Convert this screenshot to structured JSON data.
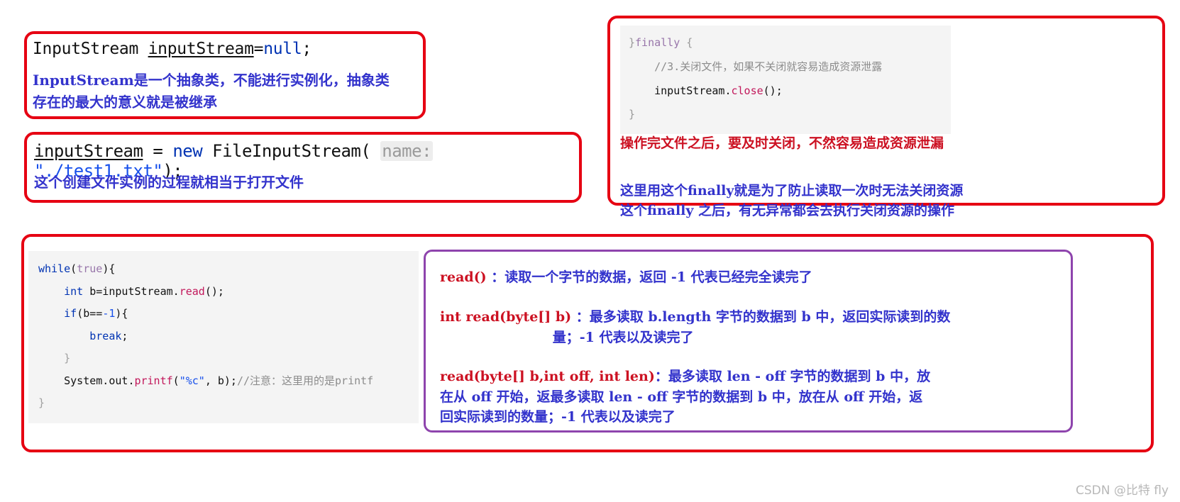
{
  "boxes": {
    "declaration": {
      "code": {
        "type_name": "InputStream",
        "variable": "inputStream",
        "assign": "=",
        "value": "null",
        "semi": ";"
      },
      "note": "InputStream是一个抽象类，不能进行实例化，抽象类\n存在的最大的意义就是被继承"
    },
    "new_stream": {
      "code": {
        "variable": "inputStream",
        "assign": " = ",
        "keyword": "new",
        "constructor": " FileInputStream(",
        "param_hint": "name:",
        "string_arg": "\"./test1.txt\"",
        "tail": ");"
      },
      "note": "这个创建文件实例的过程就相当于打开文件"
    },
    "finally_block": {
      "code_lines": [
        {
          "close_brace": "}",
          "keyword": "finally",
          "open": " {"
        },
        {
          "comment": "    //3.关闭文件，如果不关闭就容易造成资源泄露"
        },
        {
          "object": "    inputStream",
          "dot": ".",
          "method": "close",
          "tail": "();"
        },
        {
          "close_brace": "}"
        }
      ],
      "note_1": "操作完文件之后，要及时关闭，不然容易造成资源泄漏",
      "note_2": "这里用这个finally就是为了防止读取一次时无法关闭资源\n这个finally 之后，有无异常都会去执行关闭资源的操作"
    },
    "while_loop": {
      "code_lines": [
        {
          "keyword": "while",
          "p1": "(",
          "literal": "true",
          "p2": "){"
        },
        {
          "indent": "    ",
          "type": "int",
          "plain": " b=inputStream",
          "dot": ".",
          "method": "read",
          "tail": "();"
        },
        {
          "indent": "    ",
          "keyword": "if",
          "p1": "(b==",
          "number": "-1",
          "p2": "){"
        },
        {
          "indent": "        ",
          "keyword": "break",
          "tail": ";"
        },
        {
          "indent": "    ",
          "brace": "}"
        },
        {
          "indent": "    ",
          "plain": "System.out",
          "dot": ".",
          "method": "printf",
          "p1": "(",
          "string": "\"%c\"",
          "p2": ", b);",
          "comment": "//注意：这里用的是printf"
        },
        {
          "brace": "}"
        }
      ]
    },
    "read_methods": {
      "paragraphs": [
        {
          "signature": "read()",
          "description": " ：读取一个字节的数据，返回 -1 代表已经完全读完了"
        },
        {
          "signature": "int read(byte[] b)",
          "description": " ：最多读取 b.length 字节的数据到 b 中，返回实际读到的数\n                        量；-1 代表以及读完了"
        },
        {
          "signature": "read(byte[] b,int off, int len)",
          "description": "：最多读取 len - off 字节的数据到 b 中，放\n在从 off 开始，返最多读取 len - off 字节的数据到 b 中，放在从 off 开始，返\n回实际读到的数量；-1 代表以及读完了"
        }
      ]
    }
  },
  "watermark": "CSDN @比特 fly",
  "colors": {
    "annotation_red": "#e60012",
    "annotation_purple": "#8e44ad",
    "note_blue": "#3333cc",
    "signature_red": "#cc1122",
    "code_bg": "#f4f4f4"
  }
}
